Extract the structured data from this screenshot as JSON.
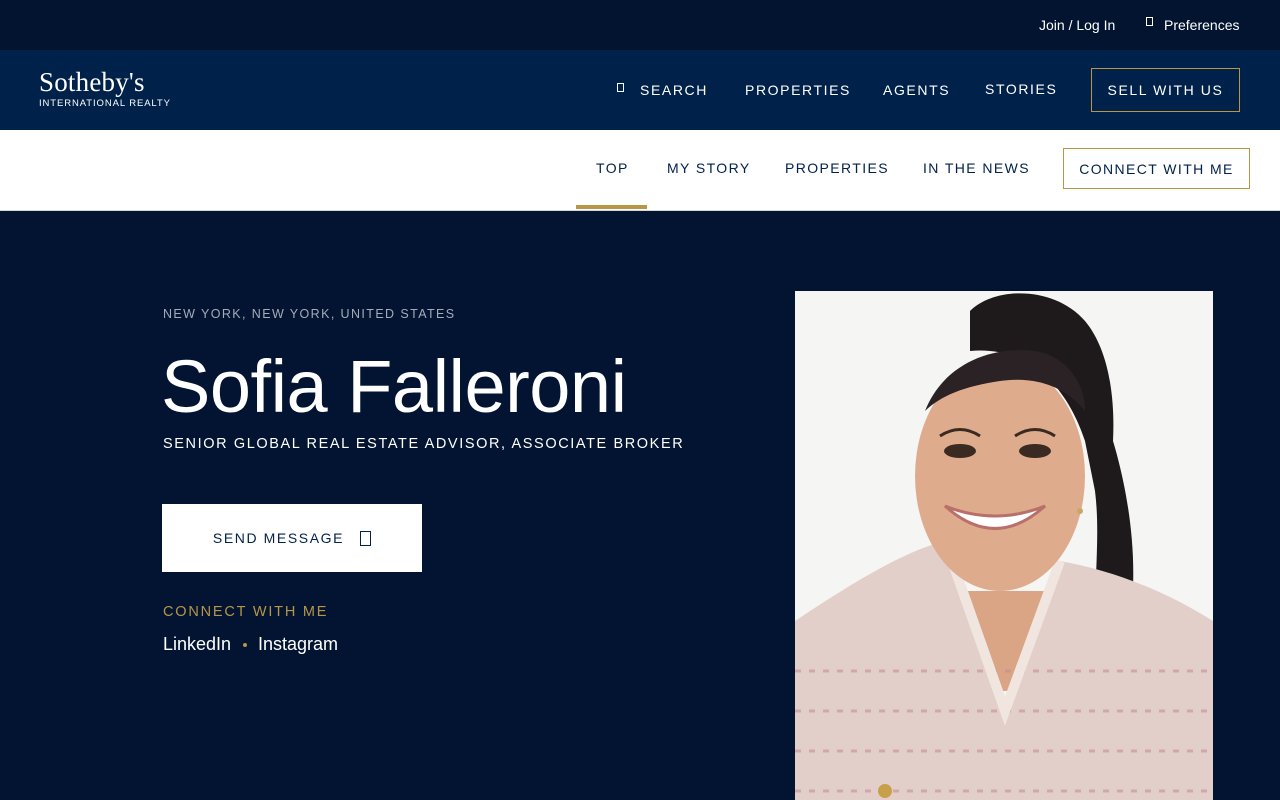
{
  "util_bar": {
    "join_label": "Join / Log In",
    "preferences_label": "Preferences"
  },
  "main_nav": {
    "logo_main": "Sotheby's",
    "logo_sub": "INTERNATIONAL REALTY",
    "search_label": "SEARCH",
    "properties_label": "PROPERTIES",
    "agents_label": "AGENTS",
    "stories_label": "STORIES",
    "sell_label": "SELL WITH US"
  },
  "sub_nav": {
    "items": [
      {
        "label": "TOP",
        "active": true
      },
      {
        "label": "MY STORY"
      },
      {
        "label": "PROPERTIES"
      },
      {
        "label": "IN THE NEWS"
      }
    ],
    "connect_label": "CONNECT WITH ME"
  },
  "hero": {
    "location": "NEW YORK, NEW YORK, UNITED STATES",
    "name": "Sofia Falleroni",
    "title": "SENIOR GLOBAL REAL ESTATE ADVISOR, ASSOCIATE BROKER",
    "send_message_label": "SEND MESSAGE",
    "connect_label": "CONNECT WITH ME",
    "social": [
      "LinkedIn",
      "Instagram"
    ]
  },
  "colors": {
    "navy": "#002149",
    "dark_navy": "#021431",
    "gold": "#b79648"
  },
  "icons": {
    "search": "search-icon",
    "preferences": "preferences-icon",
    "message": "message-icon"
  }
}
